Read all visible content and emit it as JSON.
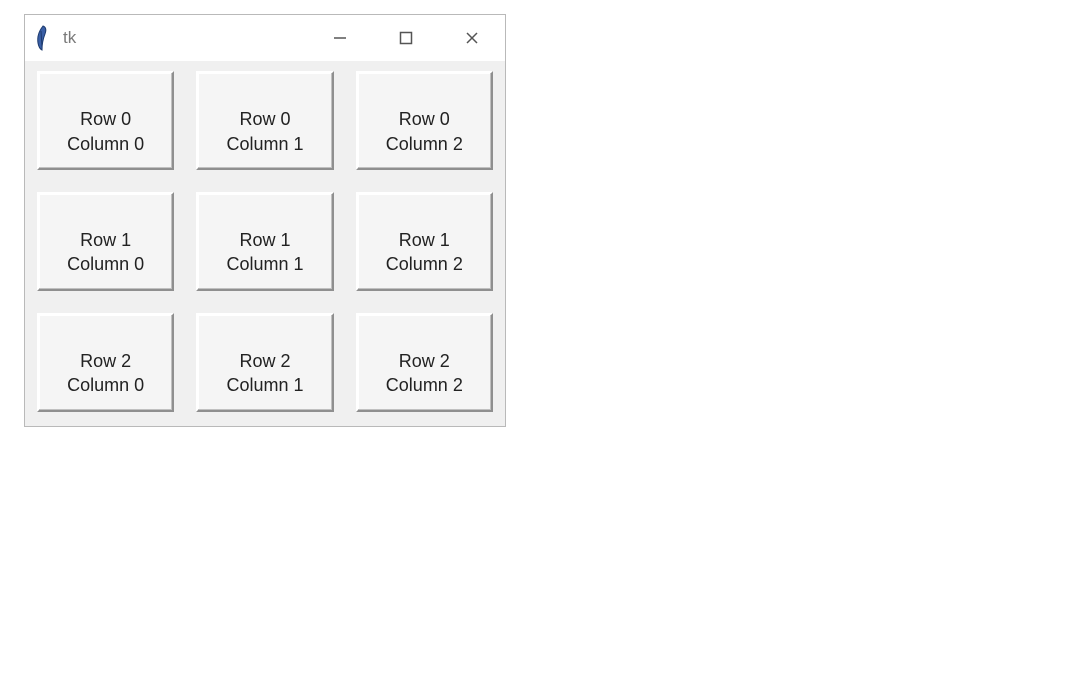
{
  "window": {
    "title": "tk",
    "icon": "feather-icon"
  },
  "controls": {
    "minimize": "minimize",
    "maximize": "maximize",
    "close": "close"
  },
  "grid": {
    "rows": 3,
    "cols": 3,
    "buttons": [
      [
        {
          "label": "Row 0\nColumn 0"
        },
        {
          "label": "Row 0\nColumn 1"
        },
        {
          "label": "Row 0\nColumn 2"
        }
      ],
      [
        {
          "label": "Row 1\nColumn 0"
        },
        {
          "label": "Row 1\nColumn 1"
        },
        {
          "label": "Row 1\nColumn 2"
        }
      ],
      [
        {
          "label": "Row 2\nColumn 0"
        },
        {
          "label": "Row 2\nColumn 1"
        },
        {
          "label": "Row 2\nColumn 2"
        }
      ]
    ]
  }
}
